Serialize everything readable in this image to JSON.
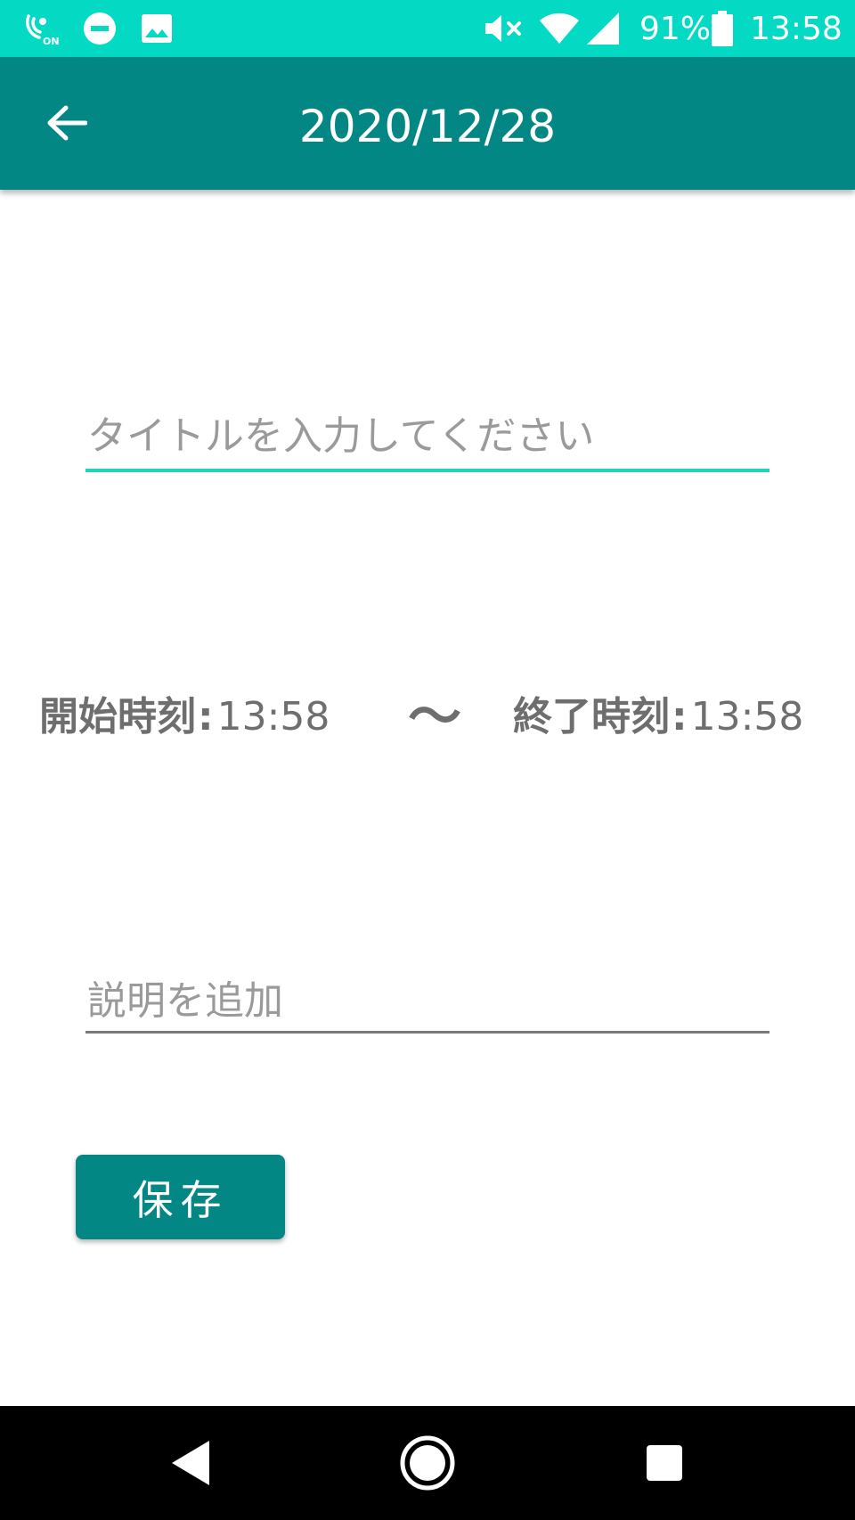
{
  "status_bar": {
    "battery_percent": "91%",
    "time": "13:58",
    "icons_left": [
      "volte-on-icon",
      "do-not-disturb-icon",
      "image-notification-icon"
    ],
    "icons_right": [
      "mute-icon",
      "wifi-icon",
      "cell-signal-icon",
      "battery-icon"
    ]
  },
  "app_bar": {
    "title": "2020/12/28",
    "back_icon": "arrow-left-icon"
  },
  "form": {
    "title_placeholder": "タイトルを入力してください",
    "title_value": "",
    "start_label": "開始時刻",
    "start_time": "13:58",
    "tilde": "〜",
    "end_label": "終了時刻",
    "end_time": "13:58",
    "time_separator": ":",
    "description_placeholder": "説明を追加",
    "description_value": "",
    "save_label": "保存"
  },
  "nav_bar": {
    "items": [
      "back-triangle-icon",
      "home-circle-icon",
      "recents-square-icon"
    ]
  },
  "colors": {
    "status_bar": "#04d9c4",
    "app_bar": "#038784",
    "accent_underline": "#1ed1c0",
    "label_gray": "#6e6e6e",
    "placeholder_gray": "#9a9a9a"
  }
}
